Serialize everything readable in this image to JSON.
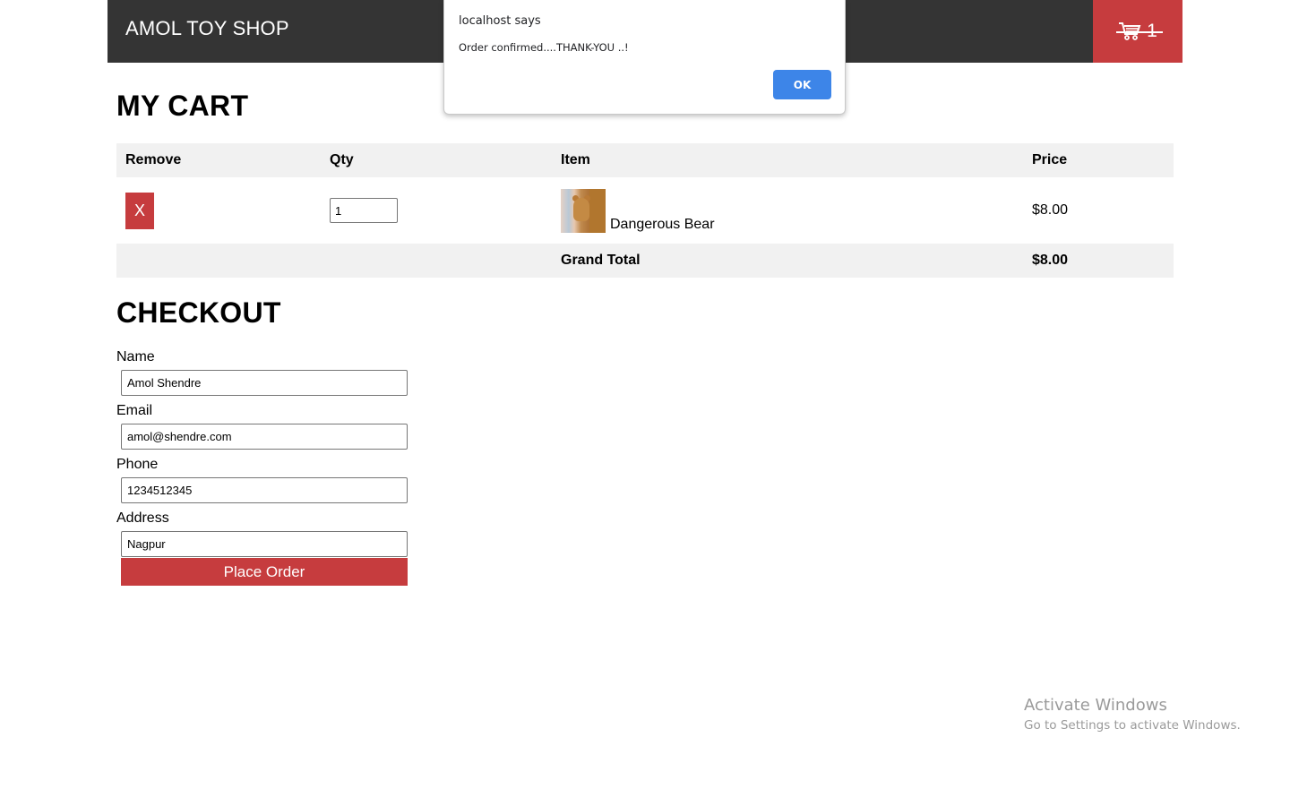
{
  "header": {
    "brand": "AMOL TOY SHOP",
    "cart_icon": "shopping-cart-icon",
    "cart_count": "1"
  },
  "cart": {
    "title": "MY CART",
    "columns": [
      "Remove",
      "Qty",
      "Item",
      "Price"
    ],
    "rows": [
      {
        "remove_label": "X",
        "qty": "1",
        "item": "Dangerous Bear",
        "price": "$8.00"
      }
    ],
    "grand_total_label": "Grand Total",
    "grand_total": "$8.00"
  },
  "checkout": {
    "title": "CHECKOUT",
    "fields": [
      {
        "label": "Name",
        "value": "Amol Shendre"
      },
      {
        "label": "Email",
        "value": "amol@shendre.com"
      },
      {
        "label": "Phone",
        "value": "1234512345"
      },
      {
        "label": "Address",
        "value": "Nagpur"
      }
    ],
    "submit_label": "Place Order"
  },
  "dialog": {
    "title": "localhost says",
    "message": "Order confirmed....THANK-YOU ..!",
    "ok_label": "OK"
  },
  "watermark": {
    "title": "Activate Windows",
    "subtitle": "Go to Settings to activate Windows."
  },
  "colors": {
    "header_bg": "#343434",
    "accent_red": "#c63c3e",
    "dialog_button": "#3d85e8",
    "table_stripe": "#f1f1f1"
  }
}
